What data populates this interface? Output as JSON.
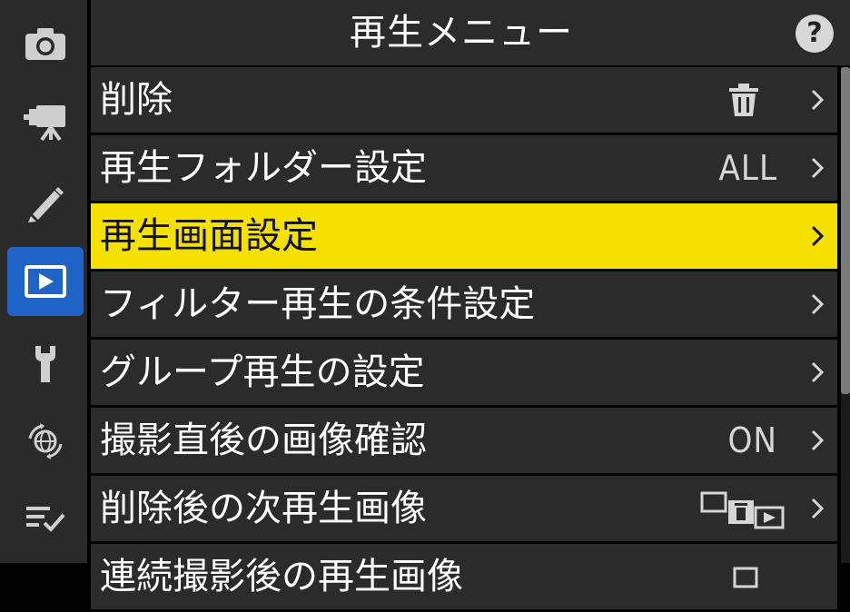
{
  "header": {
    "title": "再生メニュー",
    "help_label": "?"
  },
  "sidebar": {
    "items": [
      {
        "icon": "camera-icon"
      },
      {
        "icon": "movie-camera-icon"
      },
      {
        "icon": "pencil-icon"
      },
      {
        "icon": "playback-icon",
        "active": true
      },
      {
        "icon": "wrench-icon"
      },
      {
        "icon": "network-icon"
      },
      {
        "icon": "my-menu-icon"
      }
    ]
  },
  "menu": {
    "items": [
      {
        "label": "削除",
        "value_icon": "trash-icon"
      },
      {
        "label": "再生フォルダー設定",
        "value": "ALL"
      },
      {
        "label": "再生画面設定",
        "selected": true
      },
      {
        "label": "フィルター再生の条件設定"
      },
      {
        "label": "グループ再生の設定"
      },
      {
        "label": "撮影直後の画像確認",
        "value": "ON"
      },
      {
        "label": "削除後の次再生画像",
        "value_icon": "after-delete-next-image-icon"
      },
      {
        "label": "連続撮影後の再生画像",
        "value_icon": "partial-icon"
      }
    ]
  },
  "colors": {
    "selected": "#f5e000",
    "active_tab": "#1f63c6",
    "row_bg": "#2b2b2b"
  }
}
